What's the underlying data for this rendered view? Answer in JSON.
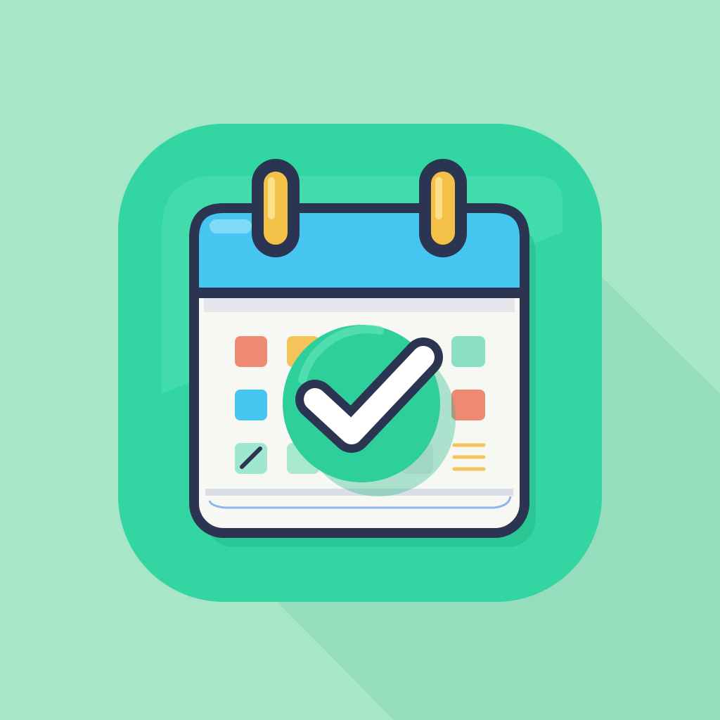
{
  "icon": {
    "name": "calendar-check-app-icon",
    "colors": {
      "background": "#a8e6c8",
      "tile": "#33d6a3",
      "tile_highlight": "#4fe3b5",
      "long_shadow": "#7fd3ad",
      "outline": "#2b3450",
      "calendar_header": "#45c6f0",
      "calendar_body": "#f7f7f4",
      "ring": "#f4c148",
      "check_circle": "#2ecf9a",
      "check_mark": "#ffffff"
    },
    "grid_cells": [
      {
        "name": "cell-red",
        "color": "#ee8a72"
      },
      {
        "name": "cell-yellow",
        "color": "#f4c35a"
      },
      {
        "name": "cell-teal",
        "color": "#8be0c4"
      },
      {
        "name": "cell-blue",
        "color": "#45c6f0"
      },
      {
        "name": "cell-red-right",
        "color": "#ee8a72"
      },
      {
        "name": "cell-mint-note",
        "color": "#9fe8cf"
      },
      {
        "name": "cell-mint",
        "color": "#a8e8cf"
      },
      {
        "name": "cell-gray",
        "color": "#e6e6e6"
      },
      {
        "name": "cell-lines",
        "color": "#f4c35a"
      }
    ]
  }
}
